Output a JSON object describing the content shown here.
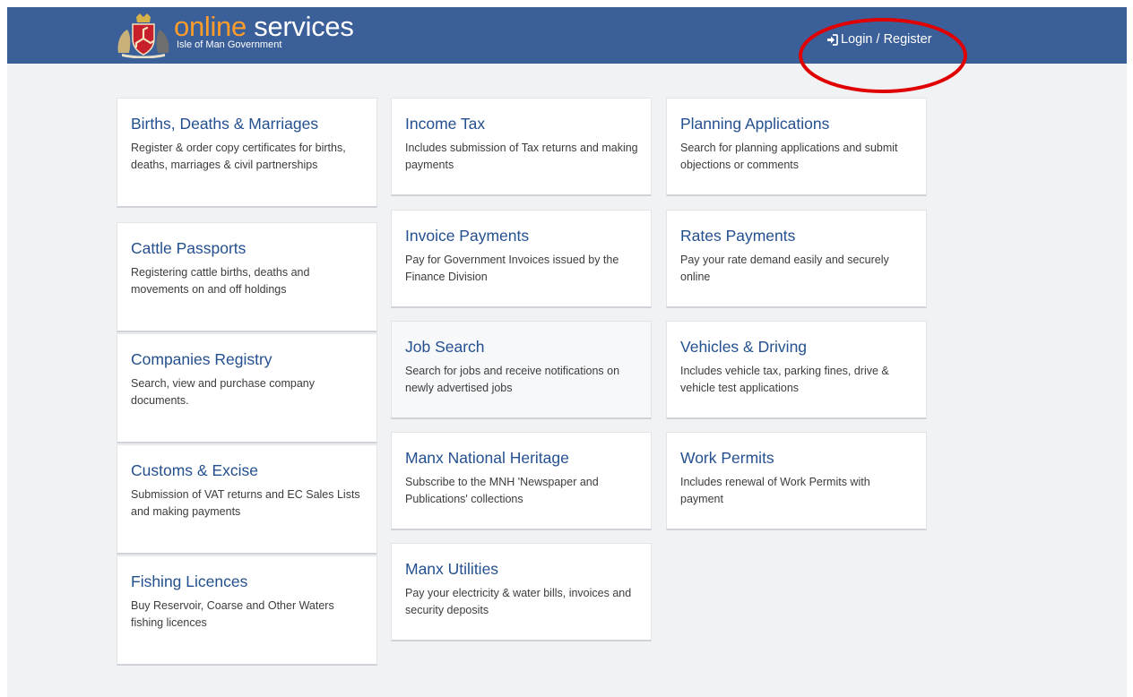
{
  "header": {
    "brand_word1": "online",
    "brand_word2": " services",
    "brand_subtitle": "Isle of Man Government",
    "login_label": "Login / Register",
    "login_icon": "sign-in-icon",
    "crest_icon": "isle-of-man-crest-icon",
    "bar_color": "#3b5f98",
    "brand_accent_color": "#ff9c2a"
  },
  "annotation": {
    "shape": "red-ellipse-around-login",
    "color": "#e00000"
  },
  "services": [
    {
      "title": "Births, Deaths & Marriages",
      "desc": "Register & order copy certificates for births, deaths, marriages & civil partnerships"
    },
    {
      "title": "Cattle Passports",
      "desc": "Registering cattle births, deaths and movements on and off holdings"
    },
    {
      "title": "Companies Registry",
      "desc": "Search, view and purchase company documents."
    },
    {
      "title": "Customs & Excise",
      "desc": "Submission of VAT returns and EC Sales Lists and making payments"
    },
    {
      "title": "Fishing Licences",
      "desc": "Buy Reservoir, Coarse and Other Waters fishing licences"
    },
    {
      "title": "Income Tax",
      "desc": "Includes submission of Tax returns and making payments"
    },
    {
      "title": "Invoice Payments",
      "desc": "Pay for Government Invoices issued by the Finance Division"
    },
    {
      "title": "Job Search",
      "desc": "Search for jobs and receive notifications on newly advertised jobs"
    },
    {
      "title": "Manx National Heritage",
      "desc": "Subscribe to the MNH 'Newspaper and Publications' collections"
    },
    {
      "title": "Manx Utilities",
      "desc": "Pay your electricity & water bills, invoices and security deposits"
    },
    {
      "title": "Planning Applications",
      "desc": "Search for planning applications and submit objections or comments"
    },
    {
      "title": "Rates Payments",
      "desc": "Pay your rate demand easily and securely online"
    },
    {
      "title": "Vehicles & Driving",
      "desc": "Includes vehicle tax, parking fines, drive & vehicle test applications"
    },
    {
      "title": "Work Permits",
      "desc": "Includes renewal of Work Permits with payment"
    }
  ]
}
